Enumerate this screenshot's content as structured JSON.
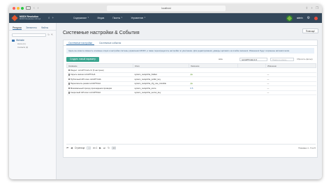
{
  "browser": {
    "url": "localhost",
    "dot_colors": [
      "#fe5f57",
      "#febc2e",
      "#28c840"
    ]
  },
  "app": {
    "brand_line1": "MODX Revolution",
    "brand_line2": "MODX Revolution 2.8.3-pl",
    "menu": [
      {
        "label": "Содержимое"
      },
      {
        "label": "Медиа"
      },
      {
        "label": "Пакеты"
      },
      {
        "label": "Управление"
      }
    ],
    "user": "admin"
  },
  "leftpane": {
    "tabs": [
      "Ресурсы",
      "Элементы",
      "Файлы"
    ],
    "root": "Website",
    "children": [
      "Home (1)",
      "Contacts (2)"
    ]
  },
  "main": {
    "title": "Системные настройки & События",
    "help_label": "Помощь!",
    "tabs": [
      "Системные настройки",
      "Системные события"
    ],
    "info_text": "Здесь вы можете изменить основные опции и настройки системы управления MODX, а также переопределить настройки по умолчанию. Для редактирования, дважды щёлкните на ячейке значения. Изменения будут сохранены автоматически.",
    "create_label": "Создать новый параметр",
    "filter_namespace": "core",
    "filter_area": "reCAPTCHA 2.0",
    "search_placeholder": "Поиск по ключу...",
    "reset_label": "Сбросить фильтр",
    "columns": [
      "Название",
      "Ключ",
      "Значение",
      "",
      "Изменено"
    ],
    "group": "Раздел: reCAPTCHA 2.0 (5 настроек)",
    "rows": [
      {
        "name": "Скрыть значок reCAPTCHA",
        "key": "system_recaptcha_hidden",
        "value": "Да",
        "modified": "—"
      },
      {
        "name": "Публичный API ключ reCAPTCHA",
        "key": "system_recaptcha_public_key",
        "value": "",
        "modified": "—"
      },
      {
        "name": "Переключить режим reCAPTCHA",
        "key": "system_recaptcha_cfg_use_invisible",
        "value": "Да",
        "modified": "—"
      },
      {
        "name": "Минимальный проход прохождения проверки",
        "key": "system_recaptcha_score",
        "value": "0.5",
        "modified": "—"
      },
      {
        "name": "Секретный API ключ reCAPTCHA",
        "key": "system_recaptcha_secret_key",
        "value": "",
        "modified": "—"
      }
    ],
    "pager": {
      "page_label": "Страница",
      "page": "1",
      "of_label": "из 1",
      "per_page": "20",
      "info": "Показано 1 - 5 из 5"
    }
  }
}
